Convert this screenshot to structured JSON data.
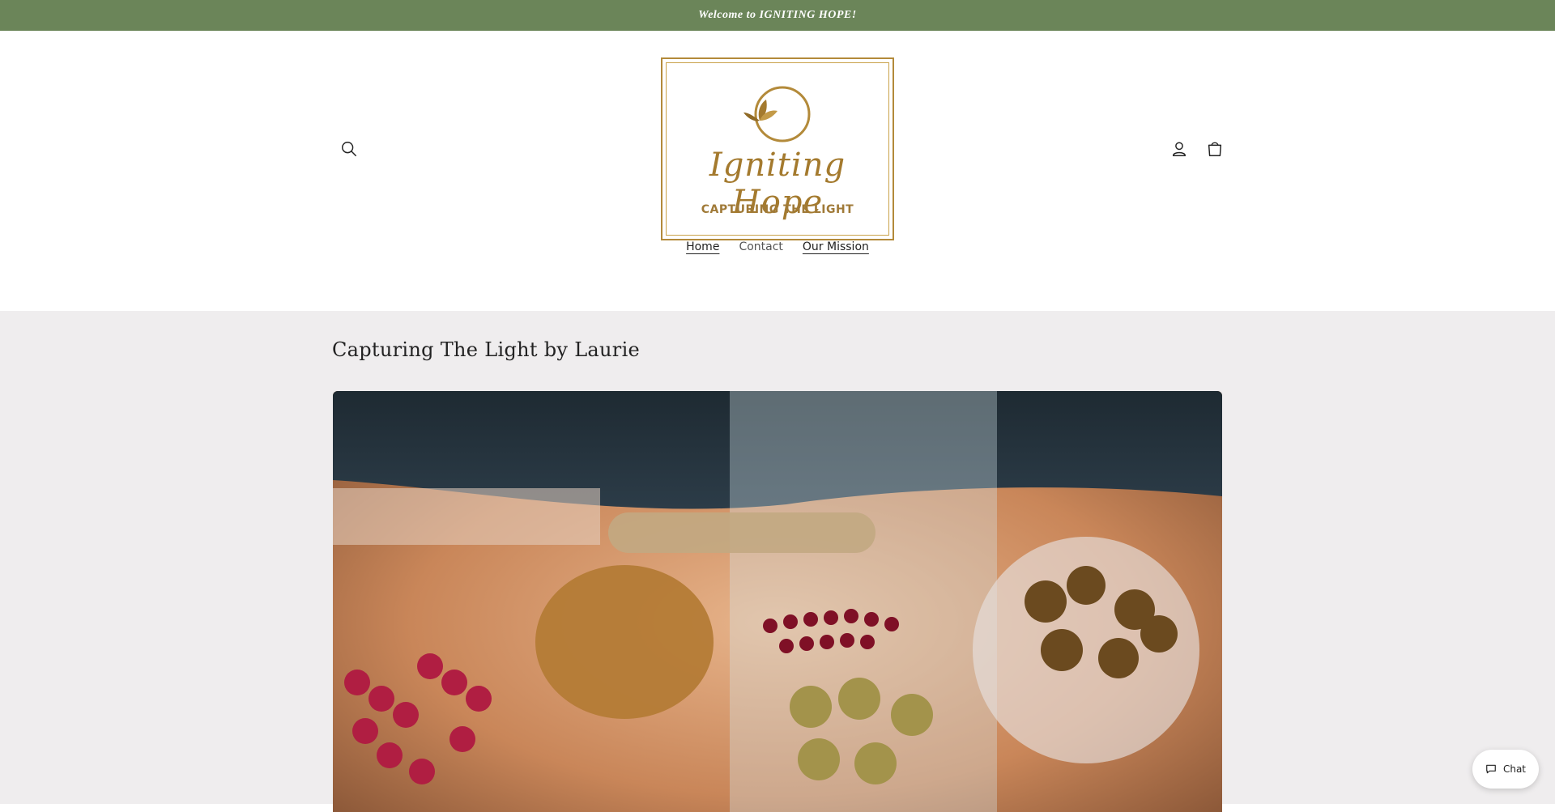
{
  "announcement": {
    "text": "Welcome to IGNITING HOPE!"
  },
  "header": {
    "logo": {
      "script_text": "Igniting Hope",
      "tagline": "CAPTURING THE LIGHT"
    },
    "icons": {
      "search": "search-icon",
      "account": "account-icon",
      "cart": "cart-icon"
    }
  },
  "nav": {
    "items": [
      {
        "label": "Home",
        "state": "active"
      },
      {
        "label": "Contact",
        "state": "normal"
      },
      {
        "label": "Our Mission",
        "state": "underlined"
      }
    ]
  },
  "main": {
    "title": "Capturing The Light by Laurie"
  },
  "chat": {
    "label": "Chat",
    "icon": "chat-bubble-icon"
  },
  "colors": {
    "announcement_bg": "#6b8559",
    "logo_gold": "#a47a2e",
    "main_bg": "#efedee"
  }
}
